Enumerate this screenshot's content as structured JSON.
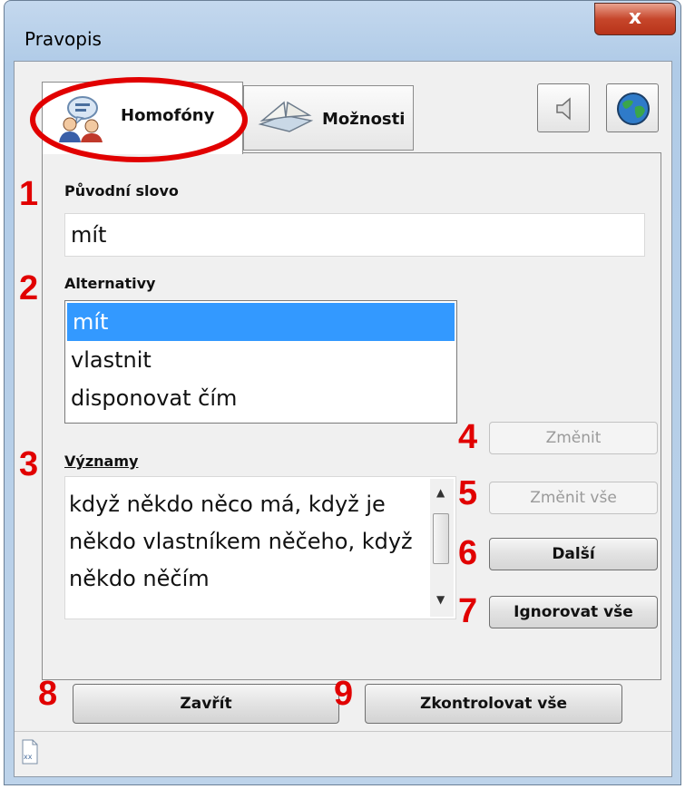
{
  "window": {
    "title": "Pravopis",
    "close_label": "x"
  },
  "tabs": [
    {
      "label": "Homofóny",
      "icon": "people-speech-icon"
    },
    {
      "label": "Možnosti",
      "icon": "book-icon"
    }
  ],
  "toolbar": {
    "speaker_icon": "speaker-icon",
    "globe_icon": "globe-icon"
  },
  "original_word": {
    "label": "Původní slovo",
    "value": "mít"
  },
  "alternatives": {
    "label": "Alternativy",
    "items": [
      "mít",
      "vlastnit",
      "disponovat čím"
    ],
    "selected_index": 0
  },
  "meanings": {
    "label": "Významy",
    "text": "když někdo něco má, když je někdo vlastníkem něčeho, když někdo něčím"
  },
  "buttons": {
    "change": "Změnit",
    "change_all": "Změnit vše",
    "next": "Další",
    "ignore_all": "Ignorovat vše",
    "close": "Zavřít",
    "check_all": "Zkontrolovat vše"
  },
  "annotations": [
    "1",
    "2",
    "3",
    "4",
    "5",
    "6",
    "7",
    "8",
    "9"
  ],
  "colors": {
    "annotation": "#e10000",
    "selection": "#3399ff",
    "highlight_circle": "#e10000"
  }
}
